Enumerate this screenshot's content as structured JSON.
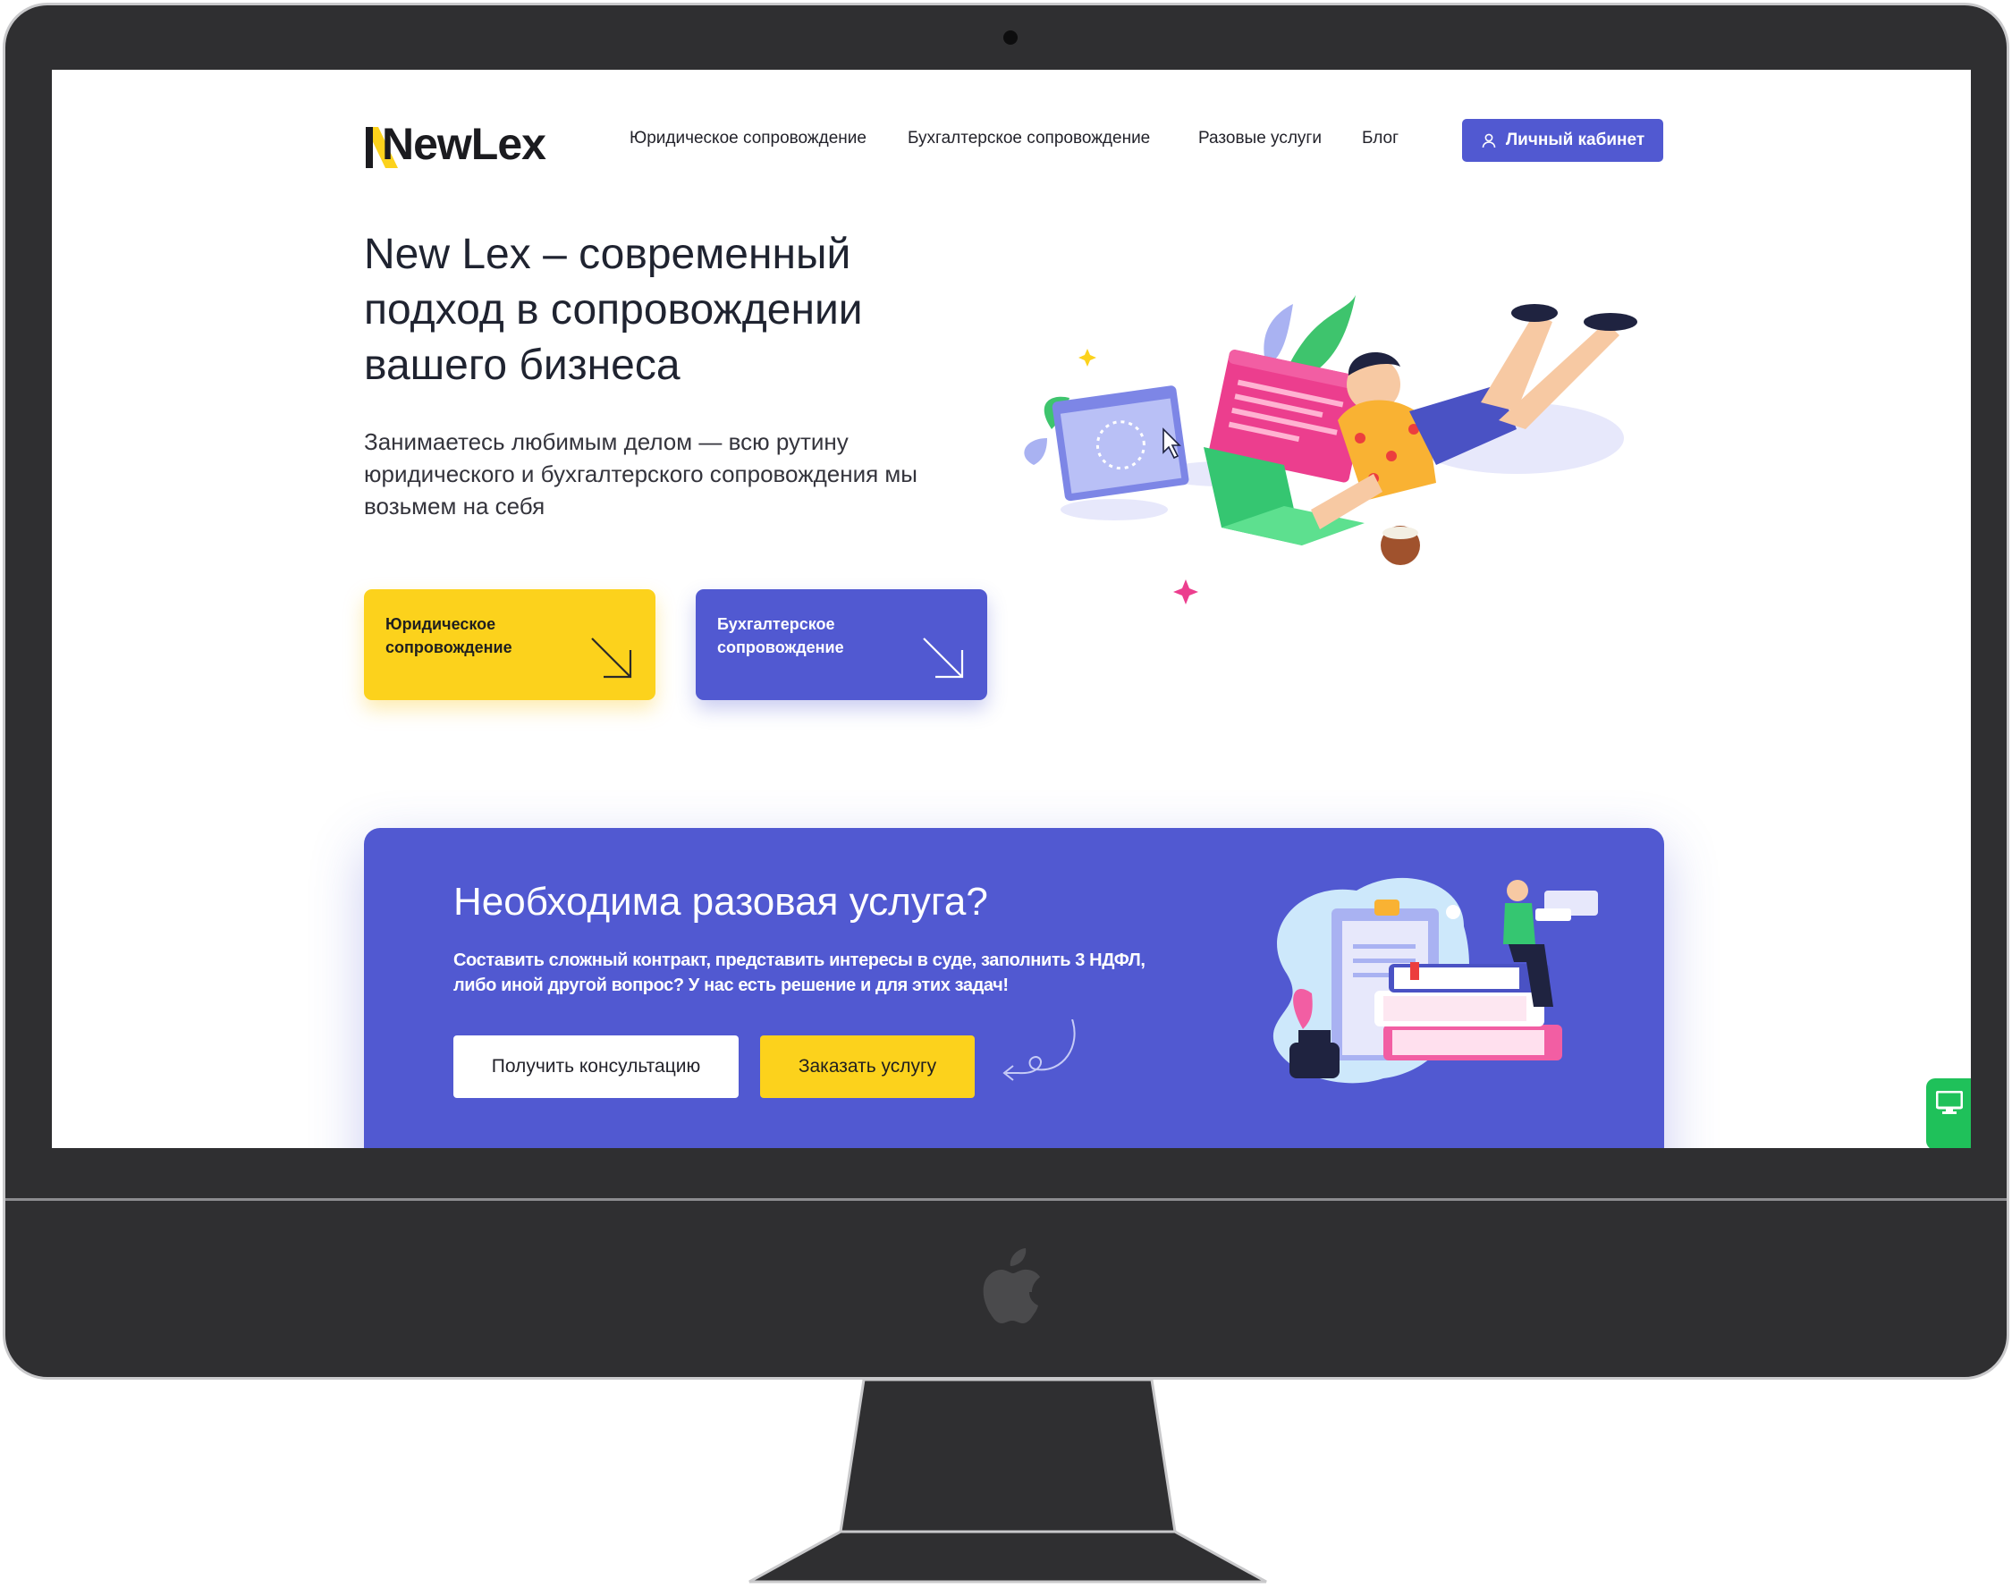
{
  "site": {
    "brand": "NewLex",
    "nav": [
      {
        "label": "Юридическое сопровождение"
      },
      {
        "label": "Бухгалтерское сопровождение"
      },
      {
        "label": "Разовые услуги"
      },
      {
        "label": "Блог"
      }
    ],
    "cabinet_label": "Личный кабинет"
  },
  "hero": {
    "title_line1": "New Lex – современный",
    "title_line2": "подход в сопровождении",
    "title_line3": "вашего бизнеса",
    "subtitle_line1": "Занимаетесь любимым делом — всю рутину",
    "subtitle_line2": "юридического и бухгалтерского сопровождения мы",
    "subtitle_line3": "возьмем на себя",
    "cards": [
      {
        "label": "Юридическое сопровождение"
      },
      {
        "label": "Бухгалтерское сопровождение"
      }
    ]
  },
  "banner": {
    "title": "Необходима разовая услуга?",
    "text_line1": "Составить сложный контракт, представить интересы в суде, заполнить 3 НДФЛ,",
    "text_line2": "либо иной другой вопрос? У нас есть решение и для этих задач!",
    "consult_label": "Получить консультацию",
    "order_label": "Заказать услугу"
  },
  "colors": {
    "accent_purple": "#5159d1",
    "accent_yellow": "#fcd21c",
    "widget_green": "#1fc15a",
    "monitor_body": "#2f2f31"
  },
  "icons": {
    "cabinet": "user-icon",
    "card_arrow": "arrow-down-right-icon",
    "widget": "monitor-icon",
    "device_logo": "apple-icon"
  }
}
